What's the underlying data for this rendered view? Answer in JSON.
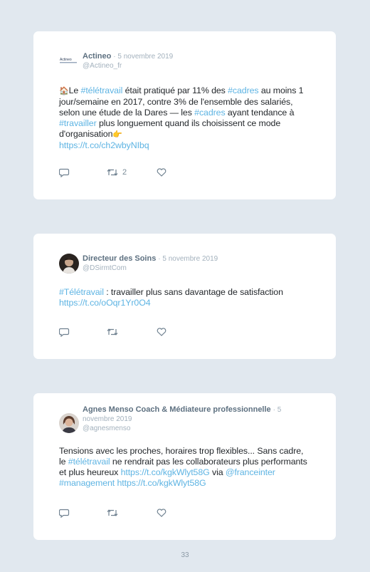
{
  "page_number": "33",
  "tweets": [
    {
      "name": "Actineo",
      "date": "5 novembre 2019",
      "handle": "@Actineo_fr",
      "avatar_text": "Actineo",
      "segments": [
        {
          "t": "🏠",
          "k": "emoji"
        },
        {
          "t": "Le ",
          "k": "text"
        },
        {
          "t": "#télétravail",
          "k": "tag"
        },
        {
          "t": " était pratiqué par 11% des ",
          "k": "text"
        },
        {
          "t": "#cadres",
          "k": "tag"
        },
        {
          "t": " au moins 1 jour/semaine en 2017, contre 3% de l'ensemble des salariés, selon une étude de la Dares — les ",
          "k": "text"
        },
        {
          "t": "#cadres",
          "k": "tag"
        },
        {
          "t": " ayant tendance à ",
          "k": "text"
        },
        {
          "t": "#travailler",
          "k": "tag"
        },
        {
          "t": " plus longuement quand ils choisissent ce mode d'organisation",
          "k": "text"
        },
        {
          "t": "👉",
          "k": "emoji"
        },
        {
          "t": "https://t.co/ch2wbyNIbq",
          "k": "link"
        }
      ],
      "retweets": "2"
    },
    {
      "name": "Directeur des Soins",
      "date": "5 novembre 2019",
      "handle": "@DSirmtCom",
      "segments": [
        {
          "t": "#Télétravail",
          "k": "tag"
        },
        {
          "t": " : travailler plus sans davantage de satisfaction ",
          "k": "text"
        },
        {
          "t": "https://t.co/oOqr1Yr0O4",
          "k": "link"
        }
      ],
      "retweets": ""
    },
    {
      "name": "Agnes Menso Coach & Médiateure professionnelle",
      "date": "5 novembre 2019",
      "handle": "@agnesmenso",
      "segments": [
        {
          "t": "Tensions avec les proches, horaires trop flexibles... Sans cadre, le ",
          "k": "text"
        },
        {
          "t": "#télétravail",
          "k": "tag"
        },
        {
          "t": " ne rendrait pas les collaborateurs plus performants et plus heureux ",
          "k": "text"
        },
        {
          "t": "https://t.co/kgkWlyt58G",
          "k": "link"
        },
        {
          "t": " via ",
          "k": "text"
        },
        {
          "t": "@franceinter",
          "k": "tag"
        },
        {
          "t": " ",
          "k": "text"
        },
        {
          "t": "#management",
          "k": "tag"
        },
        {
          "t": " ",
          "k": "text"
        },
        {
          "t": "https://t.co/kgkWlyt58G",
          "k": "link"
        }
      ],
      "retweets": ""
    }
  ],
  "icons": {
    "reply": "reply-icon",
    "retweet": "retweet-icon",
    "like": "heart-icon"
  },
  "colors": {
    "background": "#e1e8ef",
    "card": "#ffffff",
    "link": "#5eb4e3",
    "name": "#5d7080",
    "muted": "#a3b1bd"
  }
}
